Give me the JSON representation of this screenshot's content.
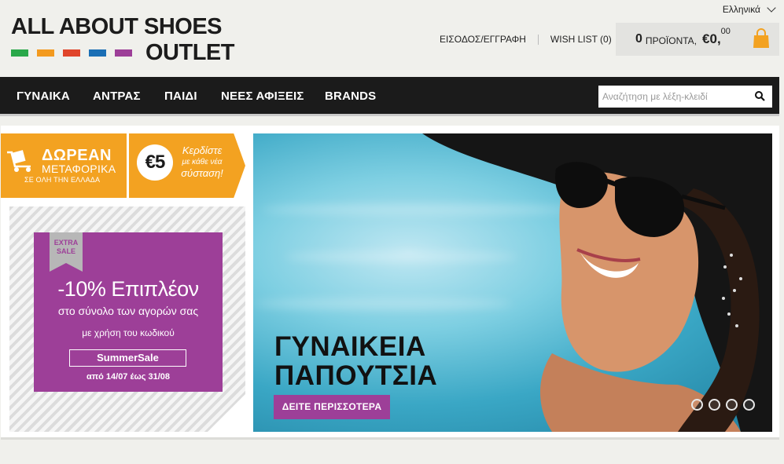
{
  "header": {
    "language": "Ελληνικά",
    "logo": {
      "line1": "ALL ABOUT SHOES",
      "line2": "OUTLET",
      "swatches": [
        "#2aa84a",
        "#f39a1f",
        "#e0452b",
        "#1b6fb5",
        "#9d3f98"
      ]
    },
    "login_label": "ΕΙΣΟΔΟΣ/ΕΓΓΡΑΦΗ",
    "wishlist_label": "WISH LIST (0)",
    "cart": {
      "count": "0",
      "products_label": "ΠΡΟΪΟΝΤΑ,",
      "price_main": "€0,",
      "price_cents": "00"
    }
  },
  "nav": {
    "items": [
      "ΓΥΝΑΙΚΑ",
      "ΑΝΤΡΑΣ",
      "ΠΑΙΔΙ",
      "ΝΕΕΣ ΑΦΙΞΕΙΣ",
      "BRANDS"
    ],
    "search_placeholder": "Αναζήτηση με λέξη-κλειδί"
  },
  "promos": {
    "shipping": {
      "line1": "ΔΩΡΕΑΝ",
      "line2": "ΜΕΤΑΦΟΡΙΚΑ",
      "line3": "ΣΕ ΟΛΗ ΤΗΝ ΕΛΛΑΔΑ"
    },
    "referral": {
      "coin": "€5",
      "line1": "Κερδίστε",
      "line2": "με κάθε νέα",
      "line3": "σύσταση!"
    }
  },
  "sale": {
    "ribbon_line1": "EXTRA",
    "ribbon_line2": "SALE",
    "headline": "-10% Επιπλέον",
    "sub1": "στο σύνολο των αγορών σας",
    "sub2": "με χρήση του κωδικού",
    "code": "SummerSale",
    "dates": "από 14/07 έως 31/08"
  },
  "hero": {
    "title_line1": "ΓΥΝΑΙΚΕΙΑ",
    "title_line2": "ΠΑΠΟΥΤΣΙΑ",
    "cta": "ΔΕΙΤΕ ΠΕΡΙΣΣΟΤΕΡΑ",
    "slides": 4
  },
  "colors": {
    "nav_bg": "#1b1b1b",
    "accent_orange": "#f3a221",
    "accent_purple": "#9d3f98",
    "cart_icon": "#f3a221"
  }
}
